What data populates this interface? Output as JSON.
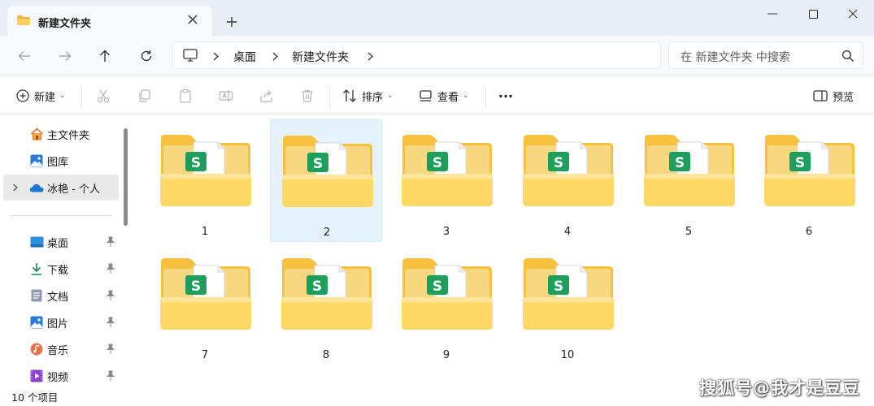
{
  "window": {
    "tab_title": "新建文件夹",
    "new_tab": "+"
  },
  "nav": {
    "breadcrumbs": [
      "桌面",
      "新建文件夹"
    ],
    "search_placeholder": "在 新建文件夹 中搜索"
  },
  "toolbar": {
    "new_label": "新建",
    "sort_label": "排序",
    "view_label": "查看",
    "more_label": "···",
    "preview_label": "预览"
  },
  "sidebar": {
    "items": [
      {
        "label": "主文件夹",
        "icon": "home-icon"
      },
      {
        "label": "图库",
        "icon": "gallery-icon"
      },
      {
        "label": "冰艳 - 个人",
        "icon": "onedrive-cloud-icon",
        "selected": true
      }
    ],
    "quick_access": [
      {
        "label": "桌面",
        "icon": "desktop-icon"
      },
      {
        "label": "下载",
        "icon": "download-icon"
      },
      {
        "label": "文档",
        "icon": "document-icon"
      },
      {
        "label": "图片",
        "icon": "pictures-icon"
      },
      {
        "label": "音乐",
        "icon": "music-icon"
      },
      {
        "label": "视频",
        "icon": "video-icon"
      }
    ]
  },
  "folders": [
    {
      "name": "1"
    },
    {
      "name": "2",
      "selected": true
    },
    {
      "name": "3"
    },
    {
      "name": "4"
    },
    {
      "name": "5"
    },
    {
      "name": "6"
    },
    {
      "name": "7"
    },
    {
      "name": "8"
    },
    {
      "name": "9"
    },
    {
      "name": "10"
    }
  ],
  "status": {
    "item_count": "10 个项目"
  },
  "watermark": "搜狐号@我才是豆豆",
  "colors": {
    "folder_back": "#f5c84a",
    "folder_front": "#ffd970",
    "sheet_green": "#1d9e5a",
    "selection": "#e5f1fb",
    "accent": "#0067c0"
  }
}
